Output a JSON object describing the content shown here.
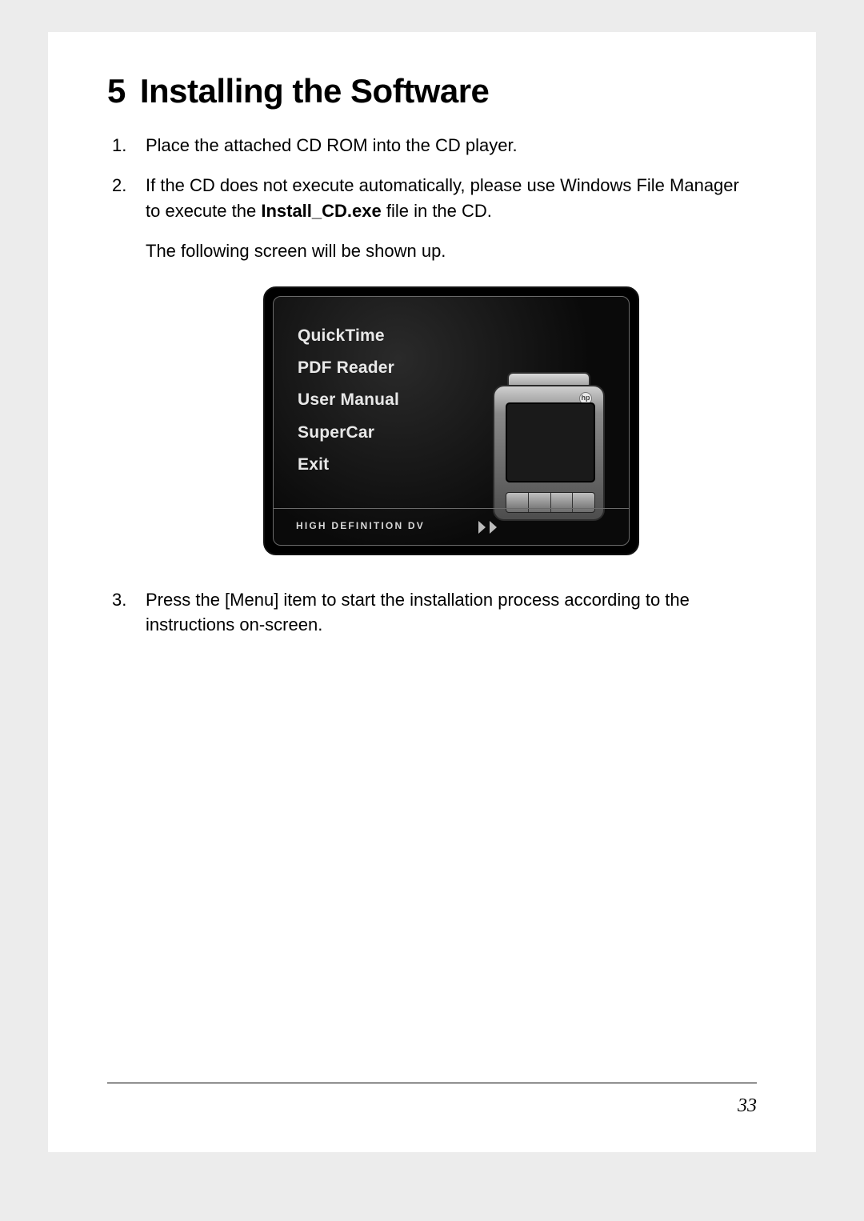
{
  "section": {
    "number": "5",
    "title": "Installing the Software"
  },
  "steps": {
    "s1": "Place the attached CD ROM into the CD player.",
    "s2_a": "If the CD does not execute automatically, please use Windows File Manager to execute the ",
    "s2_bold": "Install_CD.exe",
    "s2_b": " file in the CD.",
    "s2_sub": "The following screen will be shown up.",
    "s3": "Press the [Menu] item to start the installation process according to the instructions on-screen."
  },
  "installer": {
    "menu": {
      "quicktime": "QuickTime",
      "pdf_reader": "PDF Reader",
      "user_manual": "User Manual",
      "supercar": "SuperCar",
      "exit": "Exit"
    },
    "footer_label": "HIGH DEFINITION DV",
    "device_logo": "hp"
  },
  "page_number": "33"
}
